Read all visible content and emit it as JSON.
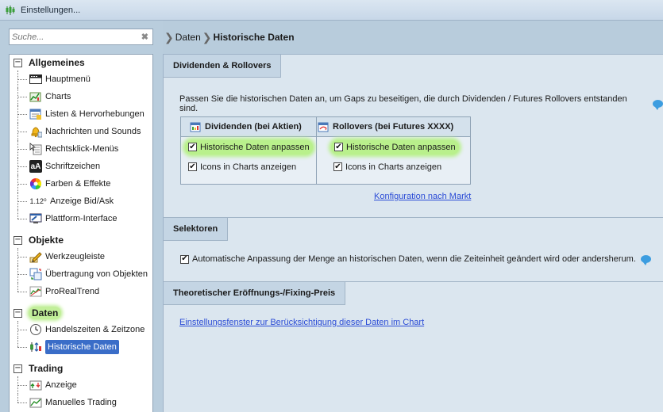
{
  "window": {
    "title": "Einstellungen..."
  },
  "search": {
    "placeholder": "Suche..."
  },
  "tree": {
    "groups": [
      {
        "label": "Allgemeines",
        "items": [
          {
            "label": "Hauptmenü",
            "icon": "menu-icon"
          },
          {
            "label": "Charts",
            "icon": "charts-icon"
          },
          {
            "label": "Listen & Hervorhebungen",
            "icon": "list-icon"
          },
          {
            "label": "Nachrichten und Sounds",
            "icon": "bell-icon"
          },
          {
            "label": "Rechtsklick-Menüs",
            "icon": "cursor-menu-icon"
          },
          {
            "label": "Schriftzeichen",
            "icon": "font-icon",
            "icon_text": "aA"
          },
          {
            "label": "Farben & Effekte",
            "icon": "color-wheel-icon"
          },
          {
            "label": "Anzeige Bid/Ask",
            "icon": "bid-ask-icon",
            "icon_text": "1.12⁰"
          },
          {
            "label": "Plattform-Interface",
            "icon": "platform-icon"
          }
        ]
      },
      {
        "label": "Objekte",
        "items": [
          {
            "label": "Werkzeugleiste",
            "icon": "pencil-icon"
          },
          {
            "label": "Übertragung von Objekten",
            "icon": "transfer-icon"
          },
          {
            "label": "ProRealTrend",
            "icon": "trend-icon"
          }
        ]
      },
      {
        "label": "Daten",
        "highlighted": true,
        "items": [
          {
            "label": "Handelszeiten & Zeitzone",
            "icon": "clock-icon"
          },
          {
            "label": "Historische Daten",
            "icon": "historical-data-icon",
            "selected": true
          }
        ]
      },
      {
        "label": "Trading",
        "items": [
          {
            "label": "Anzeige",
            "icon": "display-icon"
          },
          {
            "label": "Manuelles Trading",
            "icon": "manual-trading-icon"
          }
        ]
      }
    ]
  },
  "breadcrumb": {
    "parent": "Daten",
    "current": "Historische Daten"
  },
  "sections": {
    "dividends": {
      "title": "Dividenden & Rollovers",
      "description": "Passen Sie die historischen Daten an, um Gaps zu beseitigen, die durch Dividenden / Futures Rollovers entstanden sind.",
      "col1": {
        "header": "Dividenden (bei Aktien)",
        "check1": "Historische Daten anpassen",
        "check2": "Icons in Charts anzeigen"
      },
      "col2": {
        "header": "Rollovers (bei Futures XXXX)",
        "check1": "Historische Daten anpassen",
        "check2": "Icons in Charts anzeigen"
      },
      "market_link": "Konfiguration nach Markt"
    },
    "selectors": {
      "title": "Selektoren",
      "checkbox": "Automatische Anpassung der Menge an historischen Daten, wenn die Zeiteinheit geändert wird oder andersherum."
    },
    "theoretical": {
      "title": "Theoretischer Eröffnungs-/Fixing-Preis",
      "link": "Einstellungsfenster zur Berücksichtigung dieser Daten im Chart"
    }
  },
  "colors": {
    "selected": "#3a6dc8",
    "highlight": "#b9f08c",
    "link": "#2a4bd6"
  }
}
